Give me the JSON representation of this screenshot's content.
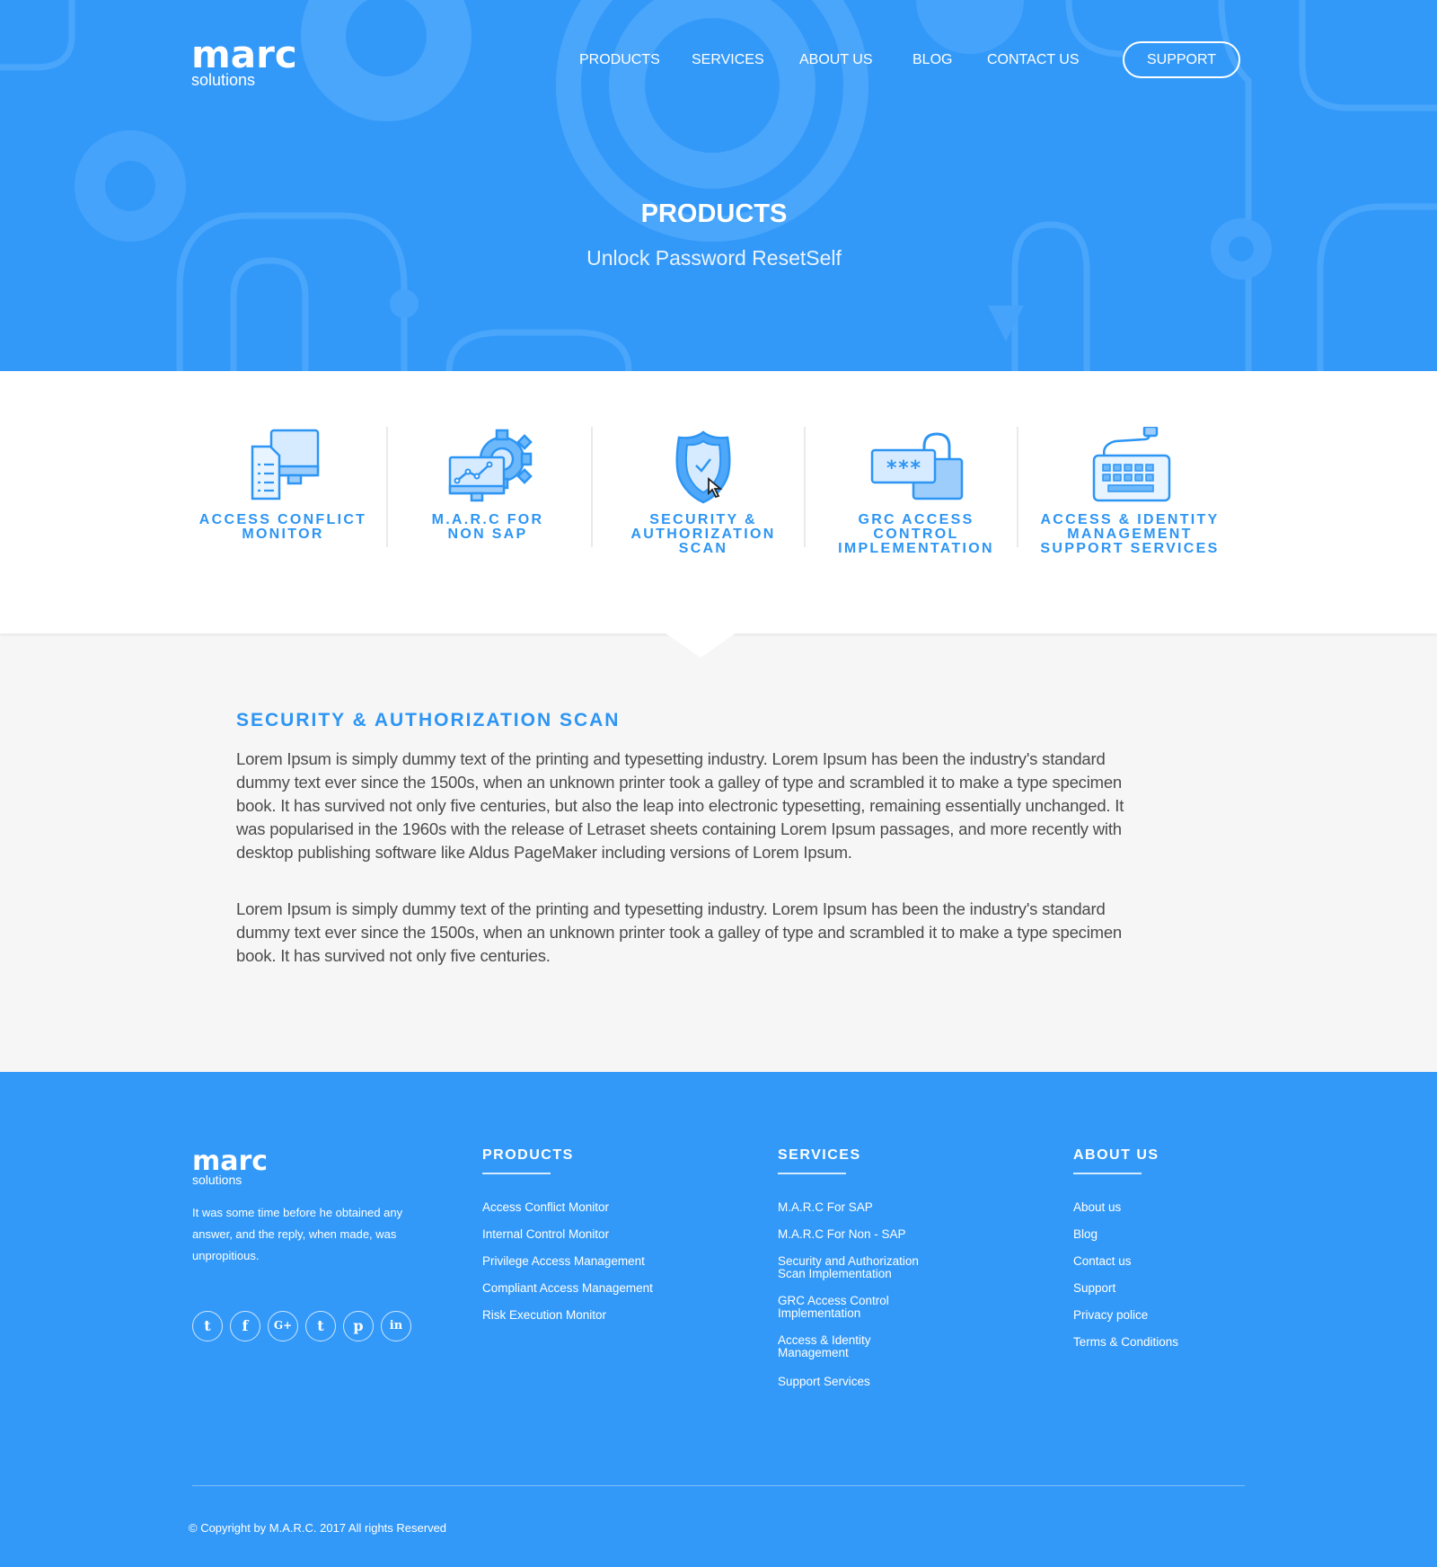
{
  "brand": {
    "logo_mark": "marc",
    "logo_sub": "solutions"
  },
  "nav": {
    "items": [
      "PRODUCTS",
      "SERVICES",
      "ABOUT US",
      "BLOG",
      "CONTACT US"
    ],
    "support_label": "SUPPORT"
  },
  "hero": {
    "title": "PRODUCTS",
    "subtitle": "Unlock Password ResetSelf"
  },
  "products": [
    {
      "label_line1": "ACCESS CONFLICT",
      "label_line2": "MONITOR",
      "label_line3": "",
      "icon": "document-monitor-icon"
    },
    {
      "label_line1": "M.A.R.C FOR",
      "label_line2": "NON SAP",
      "label_line3": "",
      "icon": "gear-chart-monitor-icon"
    },
    {
      "label_line1": "SECURITY &",
      "label_line2": "AUTHORIZATION",
      "label_line3": "SCAN",
      "icon": "shield-check-icon"
    },
    {
      "label_line1": "GRC ACCESS",
      "label_line2": "CONTROL",
      "label_line3": "IMPLEMENTATION",
      "icon": "password-lock-icon"
    },
    {
      "label_line1": "ACCESS & IDENTITY",
      "label_line2": "MANAGEMENT",
      "label_line3": "SUPPORT SERVICES",
      "icon": "keyboard-icon"
    }
  ],
  "content": {
    "heading": "SECURITY & AUTHORIZATION SCAN",
    "paragraph1": "Lorem Ipsum is simply dummy text of the printing and typesetting industry. Lorem Ipsum has been the industry's standard dummy text ever since the 1500s, when an unknown printer took a galley of type and scrambled it to make a type specimen book. It has survived not only five centuries, but also the leap into electronic typesetting, remaining essentially unchanged. It was popularised in the 1960s with the release of Letraset sheets containing Lorem Ipsum passages, and more recently with desktop publishing software like Aldus PageMaker including versions of Lorem Ipsum.",
    "paragraph2": "Lorem Ipsum is simply dummy text of the printing and typesetting industry. Lorem Ipsum has been the industry's standard dummy text ever since the 1500s, when an unknown printer took a galley of type and scrambled it to make a type specimen book. It has survived not only five centuries."
  },
  "footer": {
    "description": "It was some time before he obtained any answer, and the reply, when made, was unpropitious.",
    "social": [
      "twitter-icon",
      "facebook-icon",
      "google-plus-icon",
      "tumblr-icon",
      "pinterest-icon",
      "linkedin-icon"
    ],
    "social_glyphs": [
      "t",
      "f",
      "G+",
      "t",
      "p",
      "in"
    ],
    "products_title": "PRODUCTS",
    "products_links": [
      "Access Conflict Monitor",
      "Internal Control Monitor",
      "Privilege Access Management",
      "Compliant Access Management",
      "Risk Execution Monitor"
    ],
    "services_title": "SERVICES",
    "services_links": [
      "M.A.R.C For SAP",
      "M.A.R.C For Non - SAP",
      "Security and Authorization Scan Implementation",
      "GRC Access Control Implementation",
      "Access & Identity Management",
      "Support Services"
    ],
    "about_title": "ABOUT US",
    "about_links": [
      "About us",
      "Blog",
      "Contact us",
      "Support",
      "Privacy police",
      "Terms & Conditions"
    ],
    "copyright": "© Copyright by M.A.R.C. 2017 All rights Reserved"
  },
  "colors": {
    "brand_blue": "#3399f9",
    "accent_blue": "#2d95f4",
    "body_bg": "#f6f6f6"
  }
}
